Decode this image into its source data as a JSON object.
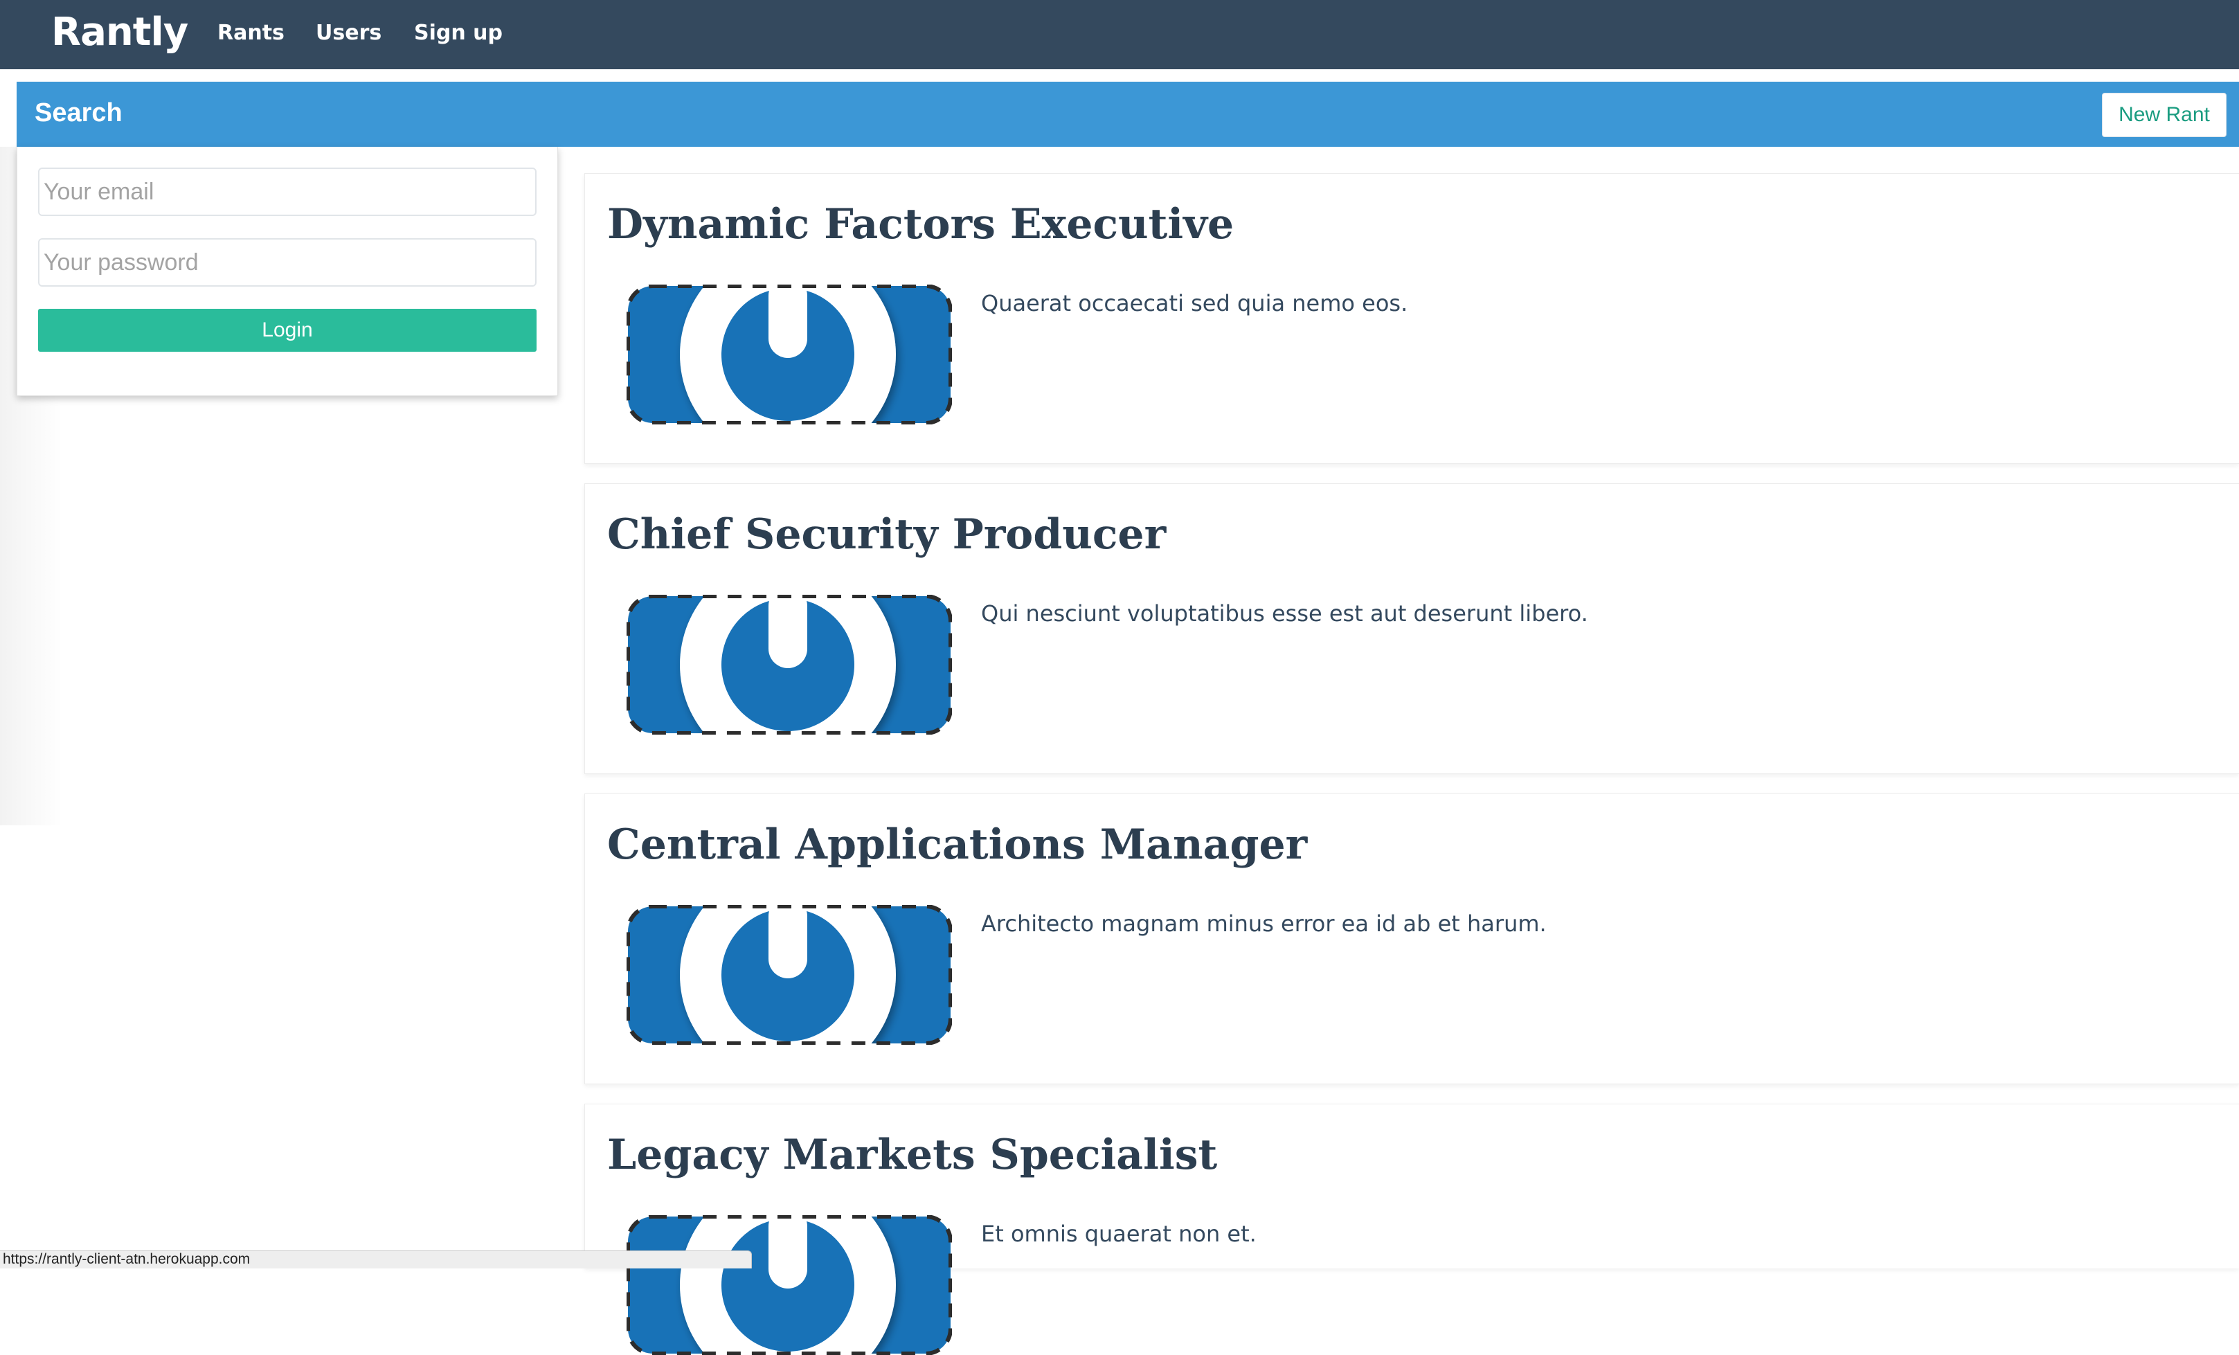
{
  "navbar": {
    "brand": "Rantly",
    "links": [
      {
        "label": "Rants"
      },
      {
        "label": "Users"
      },
      {
        "label": "Sign up"
      }
    ]
  },
  "search_bar": {
    "title": "Search",
    "new_rant_label": "New Rant"
  },
  "login": {
    "email_placeholder": "Your email",
    "email_value": "",
    "password_placeholder": "Your password",
    "password_value": "",
    "button_label": "Login"
  },
  "rants": [
    {
      "title": "Dynamic Factors Executive",
      "body": "Quaerat occaecati sed quia nemo eos.",
      "avatar_icon": "user-avatar-icon"
    },
    {
      "title": "Chief Security Producer",
      "body": "Qui nesciunt voluptatibus esse est aut deserunt libero.",
      "avatar_icon": "user-avatar-icon"
    },
    {
      "title": "Central Applications Manager",
      "body": "Architecto magnam minus error ea id ab et harum.",
      "avatar_icon": "user-avatar-icon"
    },
    {
      "title": "Legacy Markets Specialist",
      "body": "Et omnis quaerat non et.",
      "avatar_icon": "user-avatar-icon"
    }
  ],
  "status_bar": {
    "url": "https://rantly-client-atn.herokuapp.com"
  },
  "colors": {
    "navbar": "#34495e",
    "search_bar": "#3c97d6",
    "login_button": "#2abc9b",
    "avatar_blue": "#1872b7",
    "title_text": "#2c3e50"
  }
}
